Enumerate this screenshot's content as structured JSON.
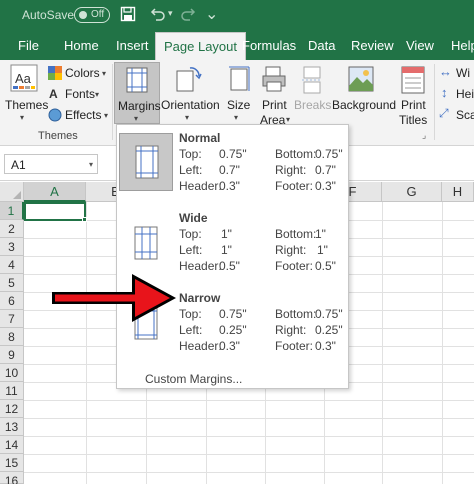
{
  "titlebar": {
    "autosave_label": "AutoSave",
    "autosave_state": "Off"
  },
  "tabs": [
    {
      "label": "File"
    },
    {
      "label": "Home"
    },
    {
      "label": "Insert"
    },
    {
      "label": "Page Layout",
      "active": true
    },
    {
      "label": "Formulas"
    },
    {
      "label": "Data"
    },
    {
      "label": "Review"
    },
    {
      "label": "View"
    },
    {
      "label": "Help"
    }
  ],
  "ribbon": {
    "themes_label": "Themes",
    "colors_label": "Colors",
    "fonts_label": "Fonts",
    "effects_label": "Effects",
    "themes_group_label": "Themes",
    "margins_label": "Margins",
    "orientation_label": "Orientation",
    "size_label": "Size",
    "print_area_label_1": "Print",
    "print_area_label_2": "Area",
    "breaks_label": "Breaks",
    "background_label": "Background",
    "print_titles_label_1": "Print",
    "print_titles_label_2": "Titles",
    "width_label": "Wi",
    "height_label": "Hei",
    "scale_label": "Sca"
  },
  "formula_bar": {
    "name_box": "A1"
  },
  "grid": {
    "columns": [
      "A",
      "B",
      "C",
      "D",
      "E",
      "F",
      "G",
      "H"
    ],
    "rows": [
      "1",
      "2",
      "3",
      "4",
      "5",
      "6",
      "7",
      "8",
      "9",
      "10",
      "11",
      "12",
      "13",
      "14",
      "15",
      "16"
    ],
    "selected_cell": "A1"
  },
  "margins_menu": {
    "presets": [
      {
        "name": "Normal",
        "top_label": "Top:",
        "top": "0.75\"",
        "bottom_label": "Bottom:",
        "bottom": "0.75\"",
        "left_label": "Left:",
        "left": "0.7\"",
        "right_label": "Right:",
        "right": "0.7\"",
        "header_label": "Header:",
        "header": "0.3\"",
        "footer_label": "Footer:",
        "footer": "0.3\""
      },
      {
        "name": "Wide",
        "top_label": "Top:",
        "top": "1\"",
        "bottom_label": "Bottom:",
        "bottom": "1\"",
        "left_label": "Left:",
        "left": "1\"",
        "right_label": "Right:",
        "right": "1\"",
        "header_label": "Header:",
        "header": "0.5\"",
        "footer_label": "Footer:",
        "footer": "0.5\""
      },
      {
        "name": "Narrow",
        "top_label": "Top:",
        "top": "0.75\"",
        "bottom_label": "Bottom:",
        "bottom": "0.75\"",
        "left_label": "Left:",
        "left": "0.25\"",
        "right_label": "Right:",
        "right": "0.25\"",
        "header_label": "Header:",
        "header": "0.3\"",
        "footer_label": "Footer:",
        "footer": "0.3\""
      }
    ],
    "custom_label": "Custom Margins..."
  },
  "colors": {
    "excel_green": "#217346",
    "arrow_red": "#e8141b"
  }
}
